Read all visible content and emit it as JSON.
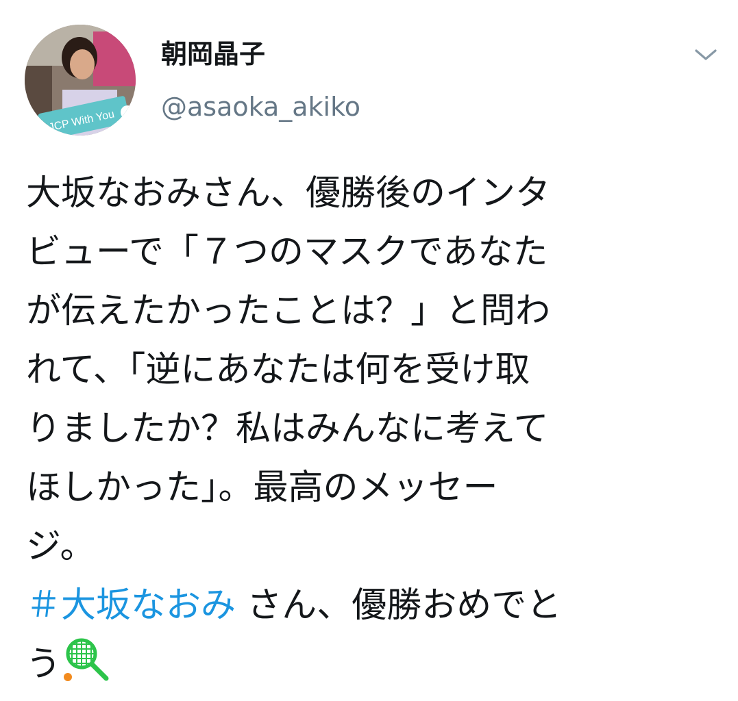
{
  "user": {
    "display_name": "朝岡晶子",
    "handle": "@asaoka_akiko",
    "avatar_sign_text": "JCP With You"
  },
  "tweet": {
    "lines": [
      "大坂なおみさん、優勝後のインタ",
      "ビューで「７つのマスクであなた",
      "が伝えたかったことは？」と問わ",
      "れて、「逆にあなたは何を受け取",
      "りましたか？私はみんなに考えて",
      "ほしかった」。最高のメッセー",
      "ジ。"
    ],
    "hashtag": "＃大坂なおみ",
    "after_hashtag": "さん、優勝おめでと",
    "final_text": "う",
    "emoji": "tennis-racket-icon"
  },
  "colors": {
    "text": "#14171a",
    "secondary": "#657786",
    "link": "#1b95e0",
    "racket": "#2cc44a",
    "ball": "#f28b1e"
  }
}
